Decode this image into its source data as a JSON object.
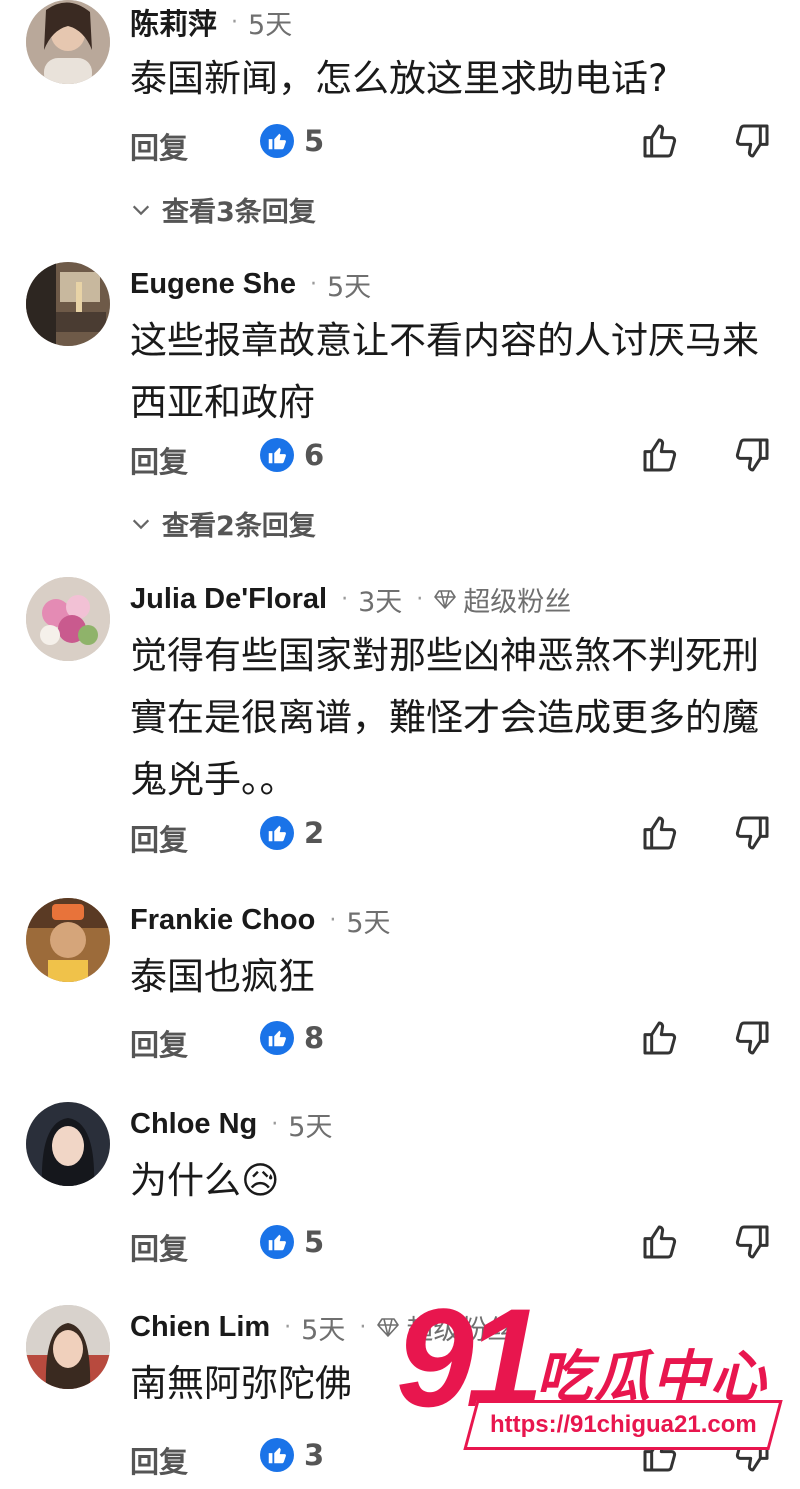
{
  "labels": {
    "reply": "回复",
    "dot": "·"
  },
  "comments": [
    {
      "name": "陈莉萍",
      "time": "5天",
      "text": "泰国新闻，怎么放这里求助电话?",
      "likes": "5",
      "view_replies": "查看3条回复",
      "avatar": "woman-photo-icon"
    },
    {
      "name": "Eugene She",
      "time": "5天",
      "text": "这些报章故意让不看内容的人讨厌马来西亚和政府",
      "likes": "6",
      "view_replies": "查看2条回复",
      "avatar": "room-photo-icon"
    },
    {
      "name": "Julia De'Floral",
      "time": "3天",
      "badge": "超级粉丝",
      "text": "觉得有些国家對那些凶神恶煞不判死刑實在是很离谱，難怪才会造成更多的魔鬼兇手。。",
      "likes": "2",
      "avatar": "flowers-photo-icon"
    },
    {
      "name": "Frankie Choo",
      "time": "5天",
      "text": "泰国也疯狂",
      "likes": "8",
      "avatar": "man-photo-icon"
    },
    {
      "name": "Chloe Ng",
      "time": "5天",
      "text": "为什么😥",
      "likes": "5",
      "avatar": "woman-photo-icon"
    },
    {
      "name": "Chien Lim",
      "time": "5天",
      "badge": "超级粉丝",
      "text": "南無阿弥陀佛",
      "likes": "3",
      "avatar": "woman-photo-icon"
    }
  ],
  "watermark": {
    "number": "91",
    "title": "吃瓜中心",
    "url": "https://91chigua21.com"
  },
  "colors": {
    "accent": "#1a73e8",
    "watermark": "#e8164e",
    "muted": "#6f6f6f"
  }
}
